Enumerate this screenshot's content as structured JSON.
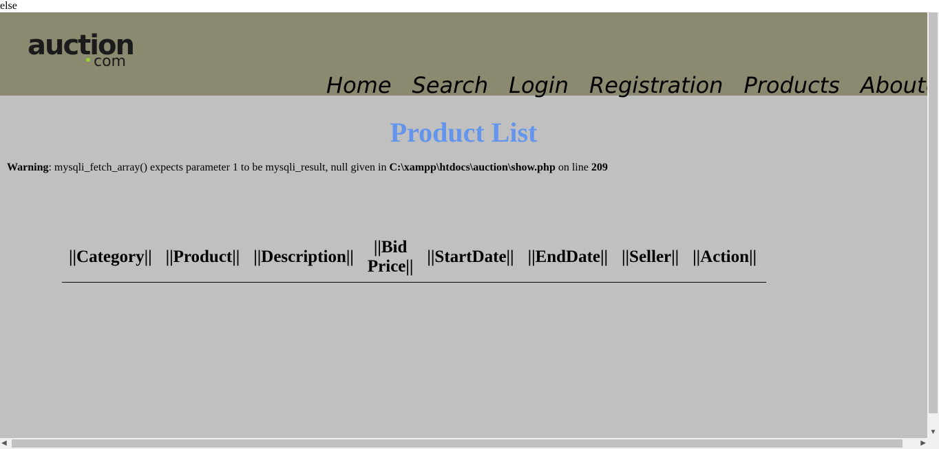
{
  "top": {
    "text": "else"
  },
  "logo": {
    "main": "auction",
    "com": "com"
  },
  "nav": [
    {
      "label": "Home"
    },
    {
      "label": "Search"
    },
    {
      "label": "Login"
    },
    {
      "label": "Registration"
    },
    {
      "label": "Products"
    },
    {
      "label": "AboutUs"
    }
  ],
  "page": {
    "title": "Product List"
  },
  "warning": {
    "label": "Warning",
    "message": ": mysqli_fetch_array() expects parameter 1 to be mysqli_result, null given in ",
    "path": "C:\\xampp\\htdocs\\auction\\show.php",
    "on_line": " on line ",
    "line": "209"
  },
  "table": {
    "headers": [
      "||Category||",
      "||Product||",
      "||Description||",
      "||Bid Price||",
      "||StartDate||",
      "||EndDate||",
      "||Seller||",
      "||Action||"
    ]
  },
  "colors": {
    "header_bg": "#8b8970",
    "page_bg": "#c0c0c0",
    "title": "#6495ed",
    "logo_dot": "#9acd32"
  }
}
